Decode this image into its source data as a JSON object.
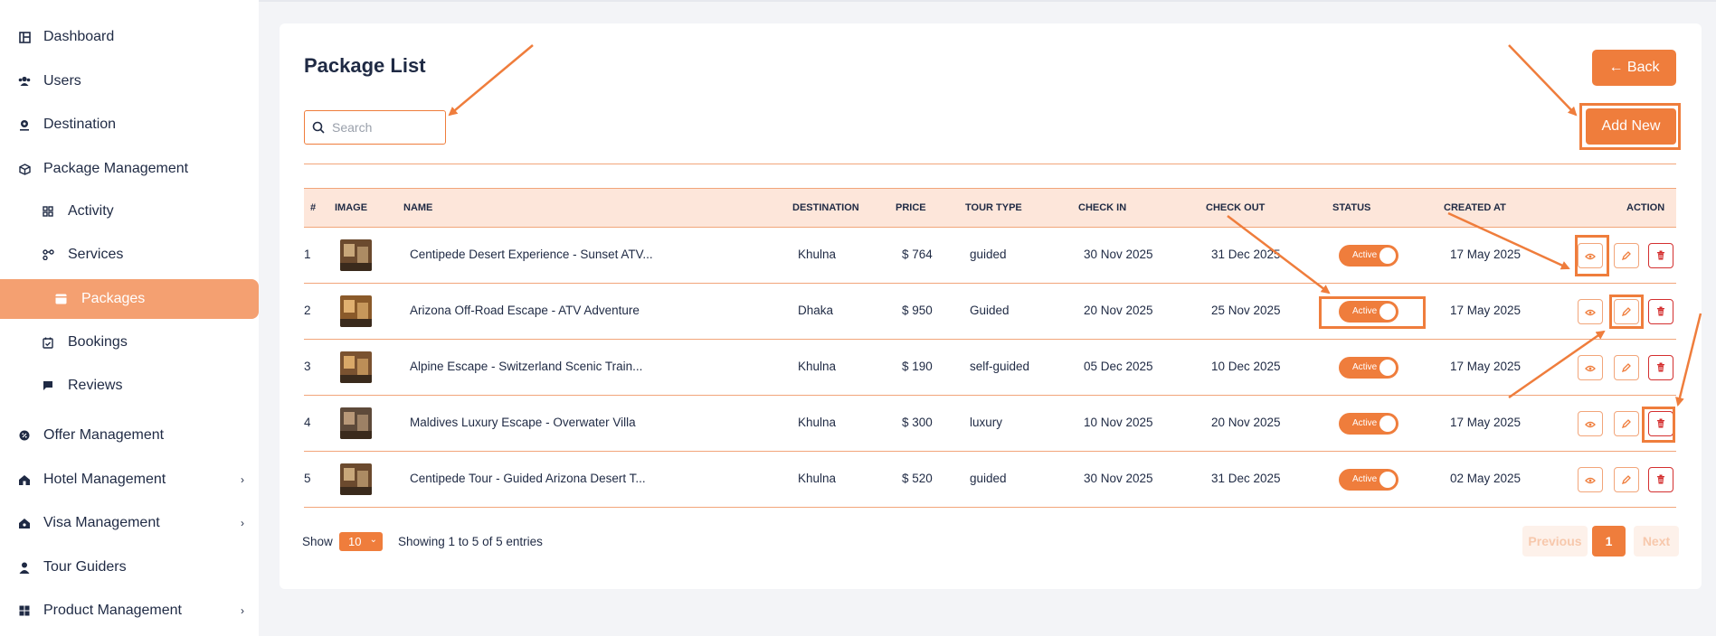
{
  "sidebar": {
    "items": [
      {
        "label": "Dashboard",
        "icon": "dashboard-icon"
      },
      {
        "label": "Users",
        "icon": "users-icon"
      },
      {
        "label": "Destination",
        "icon": "map-pin-icon"
      },
      {
        "label": "Package Management",
        "icon": "box-icon"
      },
      {
        "label": "Activity",
        "icon": "grid-icon"
      },
      {
        "label": "Services",
        "icon": "services-icon"
      },
      {
        "label": "Packages",
        "icon": "package-icon"
      },
      {
        "label": "Bookings",
        "icon": "calendar-check-icon"
      },
      {
        "label": "Reviews",
        "icon": "chat-icon"
      },
      {
        "label": "Offer Management",
        "icon": "badge-icon"
      },
      {
        "label": "Hotel Management",
        "icon": "hotel-icon"
      },
      {
        "label": "Visa Management",
        "icon": "visa-icon"
      },
      {
        "label": "Tour Guiders",
        "icon": "guide-icon"
      },
      {
        "label": "Product Management",
        "icon": "product-icon"
      }
    ],
    "active": "Packages"
  },
  "header": {
    "title": "Package List",
    "back_label": "← Back",
    "add_label": "Add New"
  },
  "search": {
    "placeholder": "Search",
    "value": ""
  },
  "table": {
    "columns": [
      "#",
      "IMAGE",
      "NAME",
      "DESTINATION",
      "PRICE",
      "TOUR TYPE",
      "CHECK IN",
      "CHECK OUT",
      "STATUS",
      "CREATED AT",
      "ACTION"
    ],
    "rows": [
      {
        "num": "1",
        "name": "Centipede Desert Experience - Sunset ATV...",
        "destination": "Khulna",
        "price": "$ 764",
        "tour_type": "guided",
        "check_in": "30 Nov 2025",
        "check_out": "31 Dec 2025",
        "status": "Active",
        "created_at": "17 May 2025"
      },
      {
        "num": "2",
        "name": "Arizona Off-Road Escape - ATV Adventure",
        "destination": "Dhaka",
        "price": "$ 950",
        "tour_type": "Guided",
        "check_in": "20 Nov 2025",
        "check_out": "25 Nov 2025",
        "status": "Active",
        "created_at": "17 May 2025"
      },
      {
        "num": "3",
        "name": "Alpine Escape - Switzerland Scenic Train...",
        "destination": "Khulna",
        "price": "$ 190",
        "tour_type": "self-guided",
        "check_in": "05 Dec 2025",
        "check_out": "10 Dec 2025",
        "status": "Active",
        "created_at": "17 May 2025"
      },
      {
        "num": "4",
        "name": "Maldives Luxury Escape - Overwater Villa",
        "destination": "Khulna",
        "price": "$ 300",
        "tour_type": "luxury",
        "check_in": "10 Nov 2025",
        "check_out": "20 Nov 2025",
        "status": "Active",
        "created_at": "17 May 2025"
      },
      {
        "num": "5",
        "name": "Centipede Tour - Guided Arizona Desert T...",
        "destination": "Khulna",
        "price": "$ 520",
        "tour_type": "guided",
        "check_in": "30 Nov 2025",
        "check_out": "31 Dec 2025",
        "status": "Active",
        "created_at": "02 May 2025"
      }
    ]
  },
  "footer": {
    "show_label": "Show",
    "page_size": "10",
    "entries_text": "Showing 1 to 5 of 5 entries",
    "prev_label": "Previous",
    "page": "1",
    "next_label": "Next"
  },
  "colors": {
    "accent": "#ef7d3c",
    "accent_light": "#fde6da",
    "danger": "#d42f2f",
    "text": "#1f2a44"
  }
}
